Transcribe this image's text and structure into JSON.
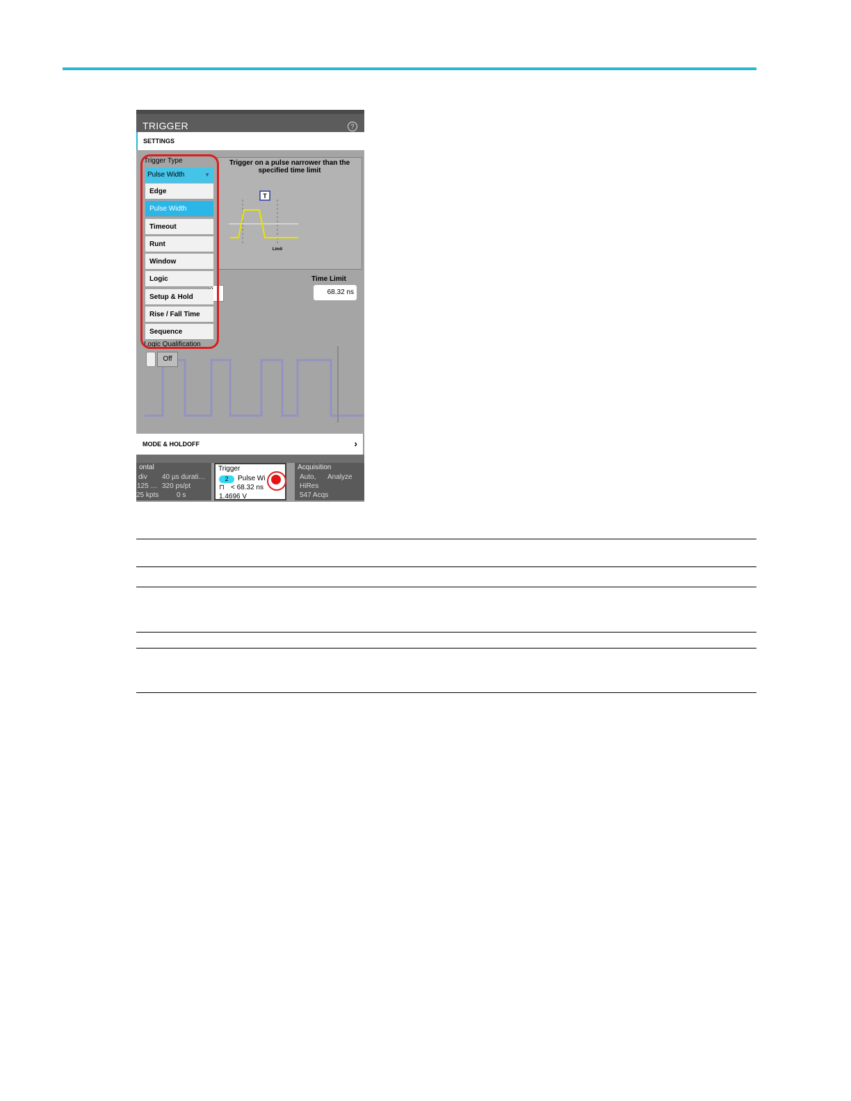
{
  "panel": {
    "title": "TRIGGER",
    "help_icon": "?",
    "settings_label": "SETTINGS",
    "trigger_type_label": "Trigger Type",
    "selected_type": "Pulse Width",
    "dropdown_items": [
      "Edge",
      "Pulse Width",
      "Timeout",
      "Runt",
      "Window",
      "Logic",
      "Setup & Hold",
      "Rise / Fall Time",
      "Sequence"
    ],
    "description": "Trigger on a pulse narrower than the specified time limit",
    "diagram_trigger_label": "T",
    "diagram_limit_label": "Limit",
    "time_limit_label": "Time Limit",
    "time_limit_value": "68.32 ns",
    "partial_hidden_char": "o",
    "logic_qualification_label": "Logic Qualification",
    "logic_qualification_value": "Off",
    "mode_holdoff_label": "MODE & HOLDOFF",
    "chevron_icon": "chevron-right"
  },
  "badges": {
    "horizontal": {
      "header": "ontal",
      "line1a": "div",
      "line1b": "40 µs durati…",
      "line2a": "125 …",
      "line2b": "320 ps/pt",
      "line3a": "25 kpts",
      "line3b": "0 s"
    },
    "trigger": {
      "header": "Trigger",
      "channel": "2",
      "type": "Pulse Wi",
      "line2": "< 68.32 ns",
      "line3": "1.4696 V"
    },
    "acquisition": {
      "header": "Acquisition",
      "line1a": "Auto,",
      "line1b": "Analyze",
      "line2": "HiRes",
      "line3": "547 Acqs"
    }
  },
  "colors": {
    "accent": "#2ab7d3",
    "highlight_ring": "#d91e1e",
    "selected_item": "#2ab7e8",
    "waveform": "#e6e600"
  }
}
